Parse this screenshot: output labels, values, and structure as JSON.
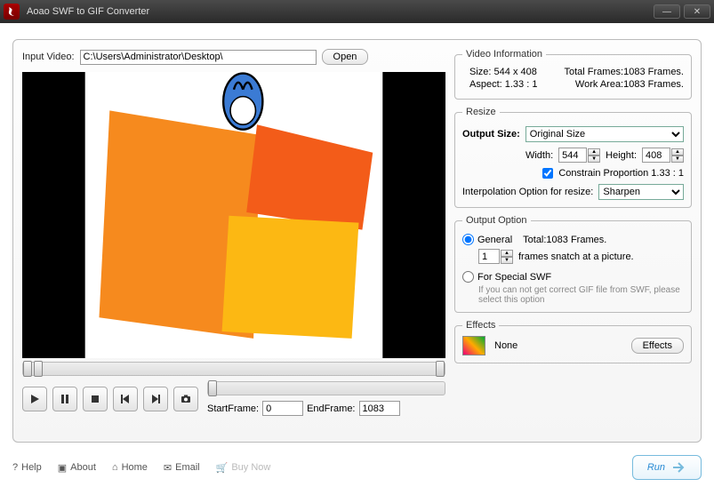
{
  "window": {
    "title": "Aoao SWF to GIF Converter"
  },
  "input": {
    "label": "Input Video:",
    "value": "C:\\Users\\Administrator\\Desktop\\",
    "open": "Open"
  },
  "videoInfo": {
    "legend": "Video Information",
    "sizeLabel": "Size:",
    "sizeValue": "544 x 408",
    "framesLabel": "Total Frames:",
    "framesValue": "1083 Frames.",
    "aspectLabel": "Aspect:",
    "aspectValue": "1.33 : 1",
    "workLabel": "Work Area:",
    "workValue": "1083 Frames."
  },
  "resize": {
    "legend": "Resize",
    "outputSizeLabel": "Output Size:",
    "outputSizeValue": "Original Size",
    "widthLabel": "Width:",
    "widthValue": "544",
    "heightLabel": "Height:",
    "heightValue": "408",
    "constrainLabel": "Constrain Proportion  1.33 : 1",
    "interpLabel": "Interpolation Option for resize:",
    "interpValue": "Sharpen"
  },
  "output": {
    "legend": "Output Option",
    "generalLabel": "General",
    "totalLabel": "Total:1083 Frames.",
    "snatchValue": "1",
    "snatchLabel": "frames snatch at a picture.",
    "specialLabel": "For Special SWF",
    "specialHint": "If you can not get correct GIF file from SWF, please select this option"
  },
  "effects": {
    "legend": "Effects",
    "value": "None",
    "button": "Effects"
  },
  "frames": {
    "startLabel": "StartFrame:",
    "startValue": "0",
    "endLabel": "EndFrame:",
    "endValue": "1083"
  },
  "footer": {
    "help": "Help",
    "about": "About",
    "home": "Home",
    "email": "Email",
    "buy": "Buy Now",
    "run": "Run"
  }
}
